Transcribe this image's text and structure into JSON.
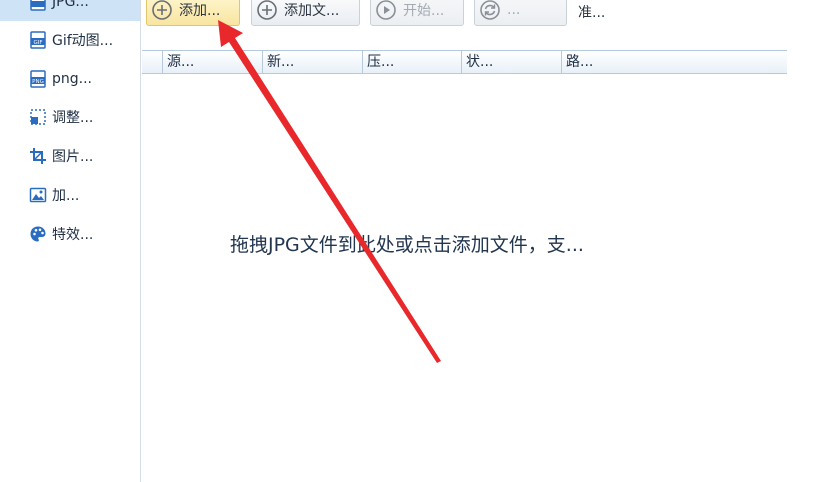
{
  "sidebar": {
    "items": [
      {
        "label": "JPG...",
        "icon": "jpg-icon"
      },
      {
        "label": "Gif动图...",
        "icon": "gif-icon"
      },
      {
        "label": "png...",
        "icon": "png-icon"
      },
      {
        "label": "调整...",
        "icon": "resize-icon"
      },
      {
        "label": "图片...",
        "icon": "crop-icon"
      },
      {
        "label": "加...",
        "icon": "image-icon"
      },
      {
        "label": "特效...",
        "icon": "palette-icon"
      }
    ]
  },
  "toolbar": {
    "add_label": "添加...",
    "add_folder_label": "添加文...",
    "start_label": "开始...",
    "refresh_label": "...",
    "status": "准..."
  },
  "table": {
    "columns": [
      "源...",
      "新...",
      "压...",
      "状...",
      "路..."
    ]
  },
  "main": {
    "hint": "拖拽JPG文件到此处或点击添加文件，支..."
  },
  "colors": {
    "accent": "#1e6fc4",
    "primary_button": "#f8e5a0",
    "annotation_arrow": "#e8282b"
  }
}
